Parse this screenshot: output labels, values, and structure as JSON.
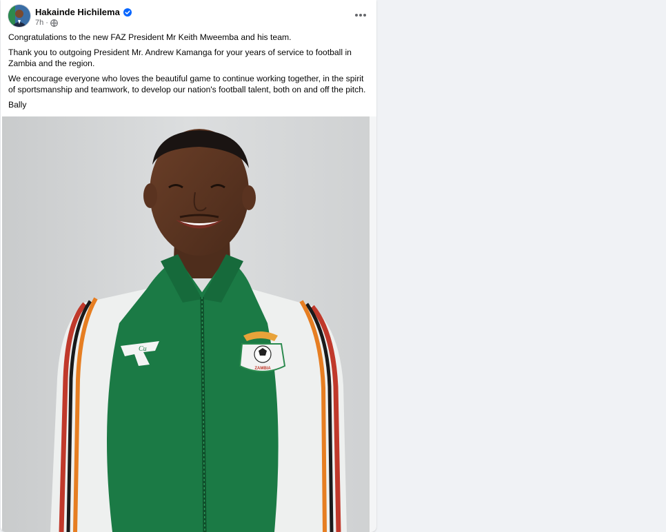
{
  "post": {
    "author": "Hakainde Hichilema",
    "verified": true,
    "timestamp": "7h",
    "separator": "·",
    "visibility_icon": "globe-icon",
    "more_icon": "more-options-icon",
    "paragraphs": [
      "Congratulations to the new FAZ President Mr Keith Mweemba and his team.",
      "Thank you to outgoing President Mr. Andrew Kamanga for your years of service to football in Zambia and the region.",
      "We encourage everyone who loves the beautiful game to continue working together, in the spirit of sportsmanship and teamwork, to develop our nation's football talent, both on and off the pitch.",
      "Bally"
    ],
    "photo": {
      "jacket_brand_text": "Cu",
      "badge_text": "ZAMBIA"
    }
  },
  "colors": {
    "page_bg": "#f0f2f5",
    "card_bg": "#ffffff",
    "verified_blue": "#0866ff",
    "secondary_text": "#65676b",
    "jacket_green": "#1b7a45",
    "jacket_white": "#eef0ef"
  }
}
